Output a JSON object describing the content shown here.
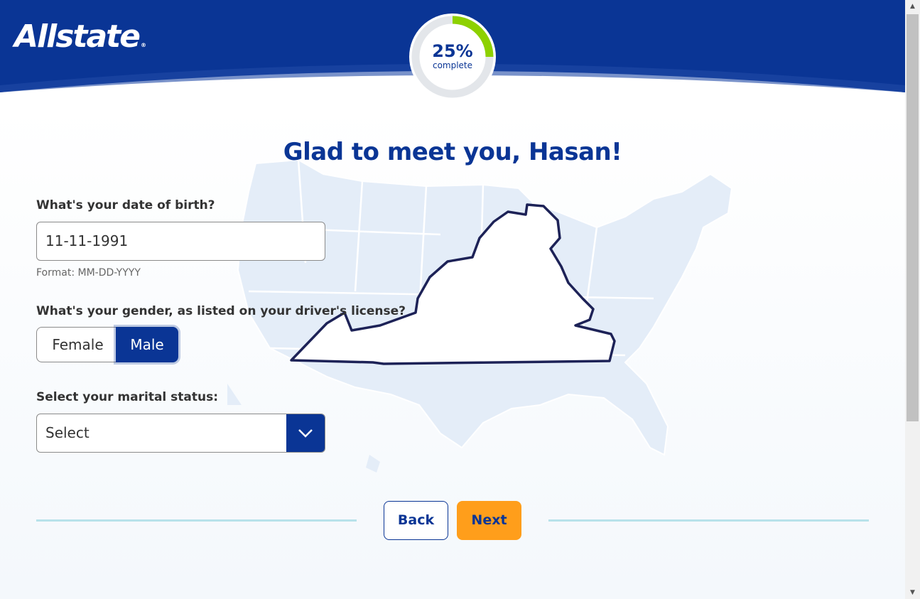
{
  "header": {
    "logo_text": "Allstate",
    "logo_reg": "®",
    "progress": {
      "percent_label": "25%",
      "sub_label": "complete",
      "fraction": 0.25
    }
  },
  "main": {
    "title": "Glad to meet you, Hasan!",
    "dob": {
      "label": "What's your date of birth?",
      "value": "11-11-1991",
      "hint": "Format: MM-DD-YYYY"
    },
    "gender": {
      "label": "What's your gender, as listed on your driver's license?",
      "options": [
        "Female",
        "Male"
      ],
      "selected": "Male"
    },
    "marital": {
      "label": "Select your marital status:",
      "value": "Select"
    }
  },
  "nav": {
    "back_label": "Back",
    "next_label": "Next"
  },
  "colors": {
    "brand_blue": "#0a3595",
    "accent_orange": "#ff9e1b",
    "progress_green": "#8dd100",
    "divider": "#b8e2ea"
  }
}
